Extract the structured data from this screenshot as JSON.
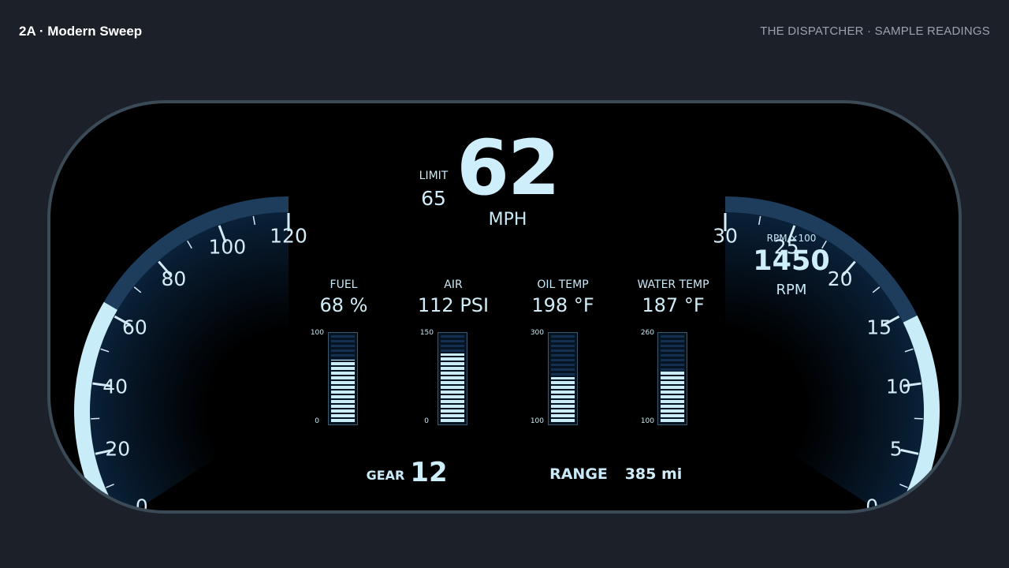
{
  "page": {
    "title": "2A · Modern Sweep",
    "subtitle": "THE DISPATCHER · SAMPLE READINGS"
  },
  "speed": {
    "value": "62",
    "unit": "MPH",
    "limit_label": "LIMIT",
    "limit_value": "65",
    "gauge_current": 62,
    "gauge_min": 0,
    "gauge_max": 120,
    "tick_labels": [
      "0",
      "20",
      "40",
      "60",
      "80",
      "100",
      "120"
    ]
  },
  "rpm": {
    "value": "1450",
    "unit": "RPM",
    "scale_label": "RPM ×100",
    "gauge_current": 14.5,
    "gauge_min": 0,
    "gauge_max": 30,
    "tick_labels": [
      "0",
      "5",
      "10",
      "15",
      "20",
      "25",
      "30"
    ]
  },
  "gauges": [
    {
      "label": "FUEL",
      "value": "68 %",
      "scale_max": "100",
      "scale_min": "0",
      "fraction": 0.68
    },
    {
      "label": "AIR",
      "value": "112 PSI",
      "scale_max": "150",
      "scale_min": "0",
      "fraction": 0.75
    },
    {
      "label": "OIL TEMP",
      "value": "198 °F",
      "scale_max": "300",
      "scale_min": "100",
      "fraction": 0.49
    },
    {
      "label": "WATER TEMP",
      "value": "187 °F",
      "scale_max": "260",
      "scale_min": "100",
      "fraction": 0.55
    }
  ],
  "footer": {
    "gear_label": "GEAR",
    "gear_value": "12",
    "range_label": "RANGE",
    "range_value": "385 mi"
  },
  "colors": {
    "active_arc": "#c8ecf8",
    "inactive_arc": "#1e3d5c",
    "bezel": "#3a4a57"
  }
}
